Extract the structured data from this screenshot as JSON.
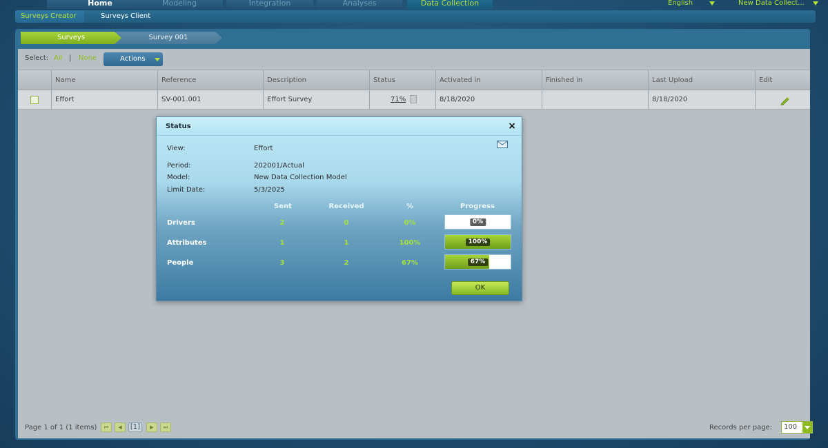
{
  "top_tabs": [
    "Home",
    "Modeling",
    "Integration",
    "Analyses",
    "Data Collection"
  ],
  "language": "English",
  "model_menu": "New Data Collect...",
  "subnav": [
    "Surveys Creator",
    "Surveys Client"
  ],
  "breadcrumbs": [
    "Surveys",
    "Survey 001"
  ],
  "select": {
    "label": "Select:",
    "all": "All",
    "separator": "|",
    "none": "None"
  },
  "actions_label": "Actions",
  "table": {
    "columns": [
      "Name",
      "Reference",
      "Description",
      "Status",
      "Activated in",
      "Finished in",
      "Last Upload",
      "Edit"
    ],
    "rows": [
      {
        "name": "Effort",
        "reference": "SV-001.001",
        "description": "Effort Survey",
        "status": "71%",
        "activated": "8/18/2020",
        "finished": "",
        "last_upload": "8/18/2020"
      }
    ]
  },
  "footer": {
    "page_info": "Page 1 of 1 (1 items)",
    "current_page": "[1]",
    "records_label": "Records per page:",
    "records_value": "100"
  },
  "modal": {
    "title": "Status",
    "close": "×",
    "info": [
      {
        "label": "View:",
        "value": "Effort"
      },
      {
        "label": "Period:",
        "value": "202001/Actual"
      },
      {
        "label": "Model:",
        "value": "New Data Collection Model"
      },
      {
        "label": "Limit Date:",
        "value": "5/3/2025"
      }
    ],
    "headers": {
      "sent": "Sent",
      "received": "Received",
      "pct": "%",
      "progress": "Progress"
    },
    "rows": [
      {
        "label": "Drivers",
        "sent": "2",
        "received": "0",
        "pct": "0%",
        "progress": 0
      },
      {
        "label": "Attributes",
        "sent": "1",
        "received": "1",
        "pct": "100%",
        "progress": 100
      },
      {
        "label": "People",
        "sent": "3",
        "received": "2",
        "pct": "67%",
        "progress": 67
      }
    ],
    "ok_label": "OK"
  },
  "colors": {
    "accent": "#a6e23a",
    "brand_blue": "#306f94"
  }
}
